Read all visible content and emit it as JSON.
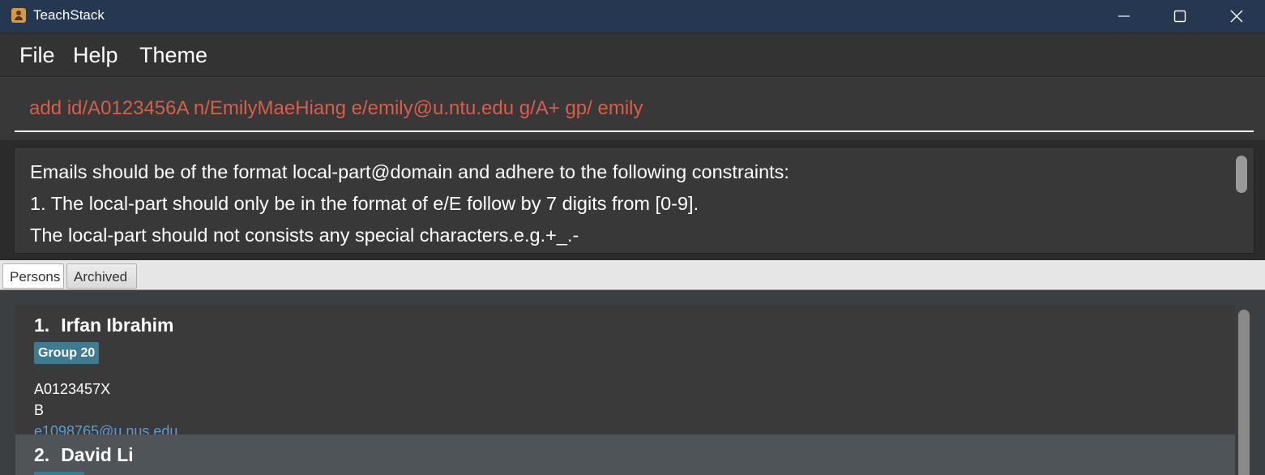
{
  "window": {
    "title": "TeachStack"
  },
  "menu": {
    "items": [
      "File",
      "Help",
      "Theme"
    ]
  },
  "command": {
    "value": "add id/A0123456A n/EmilyMaeHiang e/emily@u.ntu.edu g/A+ gp/ emily"
  },
  "result": {
    "lines": [
      "Emails should be of the format local-part@domain and adhere to the following constraints:",
      "1. The local-part should only be in the format of e/E follow by 7 digits from [0-9].",
      "The local-part should not consists any special characters.e.g.+_.-"
    ]
  },
  "tabs": [
    {
      "label": "Persons",
      "active": true
    },
    {
      "label": "Archived",
      "active": false
    }
  ],
  "persons": [
    {
      "index": "1.",
      "name": "Irfan Ibrahim",
      "group": "Group 20",
      "id": "A0123457X",
      "grade": "B",
      "email": "e1098765@u.nus.edu"
    },
    {
      "index": "2.",
      "name": "David Li"
    }
  ],
  "colors": {
    "titlebar": "#263752",
    "error_text": "#d65e4a",
    "tag": "#3e7b91",
    "email_link": "#5a9ed6"
  },
  "icons": {
    "app": "contact-book-icon",
    "minimize": "minimize-icon",
    "maximize": "maximize-icon",
    "close": "close-icon"
  }
}
